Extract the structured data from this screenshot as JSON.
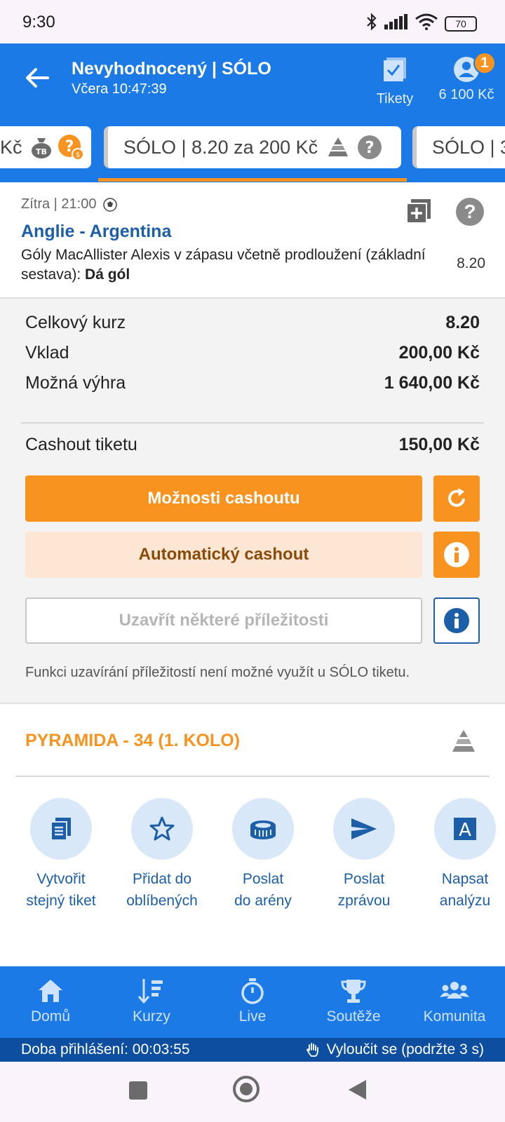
{
  "status_bar": {
    "time": "9:30",
    "battery": "70"
  },
  "header": {
    "title": "Nevyhodnocený | SÓLO",
    "subtitle": "Včera 10:47:39",
    "tickets_label": "Tikety",
    "balance": "6 100 Kč",
    "notification_count": "1"
  },
  "tabs": [
    {
      "text": "Kč"
    },
    {
      "text": "SÓLO  | 8.20 za 200 Kč"
    },
    {
      "text": "SÓLO  | 3"
    }
  ],
  "event": {
    "date": "Zítra  | 21:00",
    "match": "Anglie - Argentina",
    "desc_text": "Góly MacAllister Alexis v zápasu včetně prodloužení (základní sestava): ",
    "desc_bold": "Dá gól",
    "odd": "8.20"
  },
  "summary": {
    "total_odds_label": "Celkový kurz",
    "total_odds_value": "8.20",
    "stake_label": "Vklad",
    "stake_value": "200,00 Kč",
    "win_label": "Možná výhra",
    "win_value": "1 640,00 Kč",
    "cashout_label": "Cashout tiketu",
    "cashout_value": "150,00 Kč",
    "cashout_options_button": "Možnosti cashoutu",
    "auto_cashout_button": "Automatický cashout",
    "close_some_button": "Uzavřít některé příležitosti",
    "note": "Funkci uzavírání příležitostí není možné využít u SÓLO tiketu."
  },
  "pyramid": {
    "label": "PYRAMIDA - 34 (1. KOLO)"
  },
  "actions": [
    {
      "line1": "Vytvořit",
      "line2": "stejný tiket"
    },
    {
      "line1": "Přidat do",
      "line2": "oblíbených"
    },
    {
      "line1": "Poslat",
      "line2": "do arény"
    },
    {
      "line1": "Poslat",
      "line2": "zprávou"
    },
    {
      "line1": "Napsat",
      "line2": "analýzu"
    }
  ],
  "bottom_nav": [
    {
      "label": "Domů"
    },
    {
      "label": "Kurzy"
    },
    {
      "label": "Live"
    },
    {
      "label": "Soutěže"
    },
    {
      "label": "Komunita"
    }
  ],
  "login_bar": {
    "session": "Doba přihlášení: 00:03:55",
    "exclude": "Vyloučit se (podržte 3 s)"
  },
  "colors": {
    "brand_blue": "#1b7ae5",
    "accent_orange": "#f7931e",
    "dark_blue": "#0d4ea0",
    "link_blue": "#1c5fa8"
  }
}
